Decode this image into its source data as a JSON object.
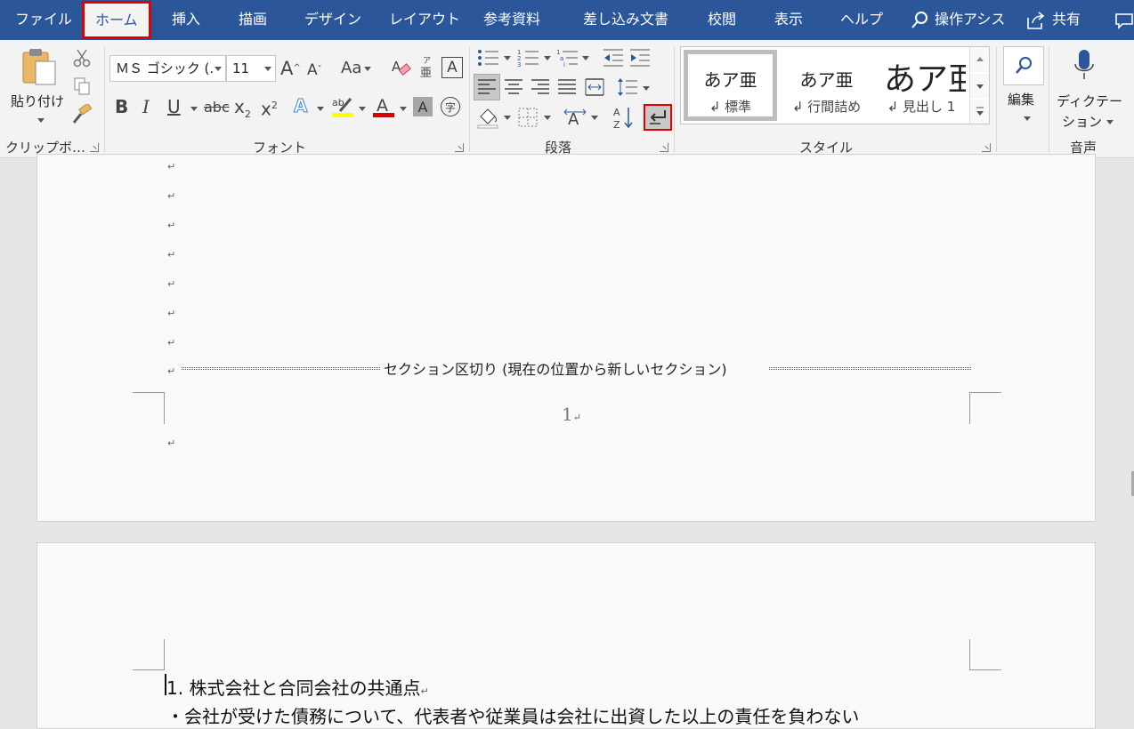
{
  "tabs": [
    {
      "label": "ファイル",
      "active": false
    },
    {
      "label": "ホーム",
      "active": true
    },
    {
      "label": "挿入",
      "active": false
    },
    {
      "label": "描画",
      "active": false
    },
    {
      "label": "デザイン",
      "active": false
    },
    {
      "label": "レイアウト",
      "active": false
    },
    {
      "label": "参考資料",
      "active": false
    },
    {
      "label": "差し込み文書",
      "active": false
    },
    {
      "label": "校閲",
      "active": false
    },
    {
      "label": "表示",
      "active": false
    },
    {
      "label": "ヘルプ",
      "active": false
    }
  ],
  "tellme": {
    "label": "操作アシス"
  },
  "share": {
    "label": "共有"
  },
  "ribbon": {
    "clipboard": {
      "paste_label": "貼り付け",
      "group_label": "クリップボ…"
    },
    "font": {
      "font_name": "ＭＳ ゴシック (.",
      "font_size": "11",
      "change_case": "Aa",
      "group_label": "フォント"
    },
    "paragraph": {
      "group_label": "段落"
    },
    "styles": {
      "group_label": "スタイル",
      "items": [
        {
          "sample": "あア亜",
          "name": "標準"
        },
        {
          "sample": "あア亜",
          "name": "行間詰め"
        },
        {
          "sample": "あア亜",
          "name": "見出し 1"
        }
      ]
    },
    "editing": {
      "label": "編集"
    },
    "voice": {
      "label_line1": "ディクテー",
      "label_line2": "ション",
      "group_label": "音声"
    }
  },
  "document": {
    "section_break": "セクション区切り (現在の位置から新しいセクション)",
    "page_number": "1",
    "heading": "1. 株式会社と合同会社の共通点",
    "bullet": "・会社が受けた債務について、代表者や従業員は会社に出資した以上の責任を負わない"
  },
  "colors": {
    "accent": "#2b579a",
    "highlight_border": "#e00000",
    "highlighter": "#ffff00",
    "font_color": "#e00000"
  }
}
